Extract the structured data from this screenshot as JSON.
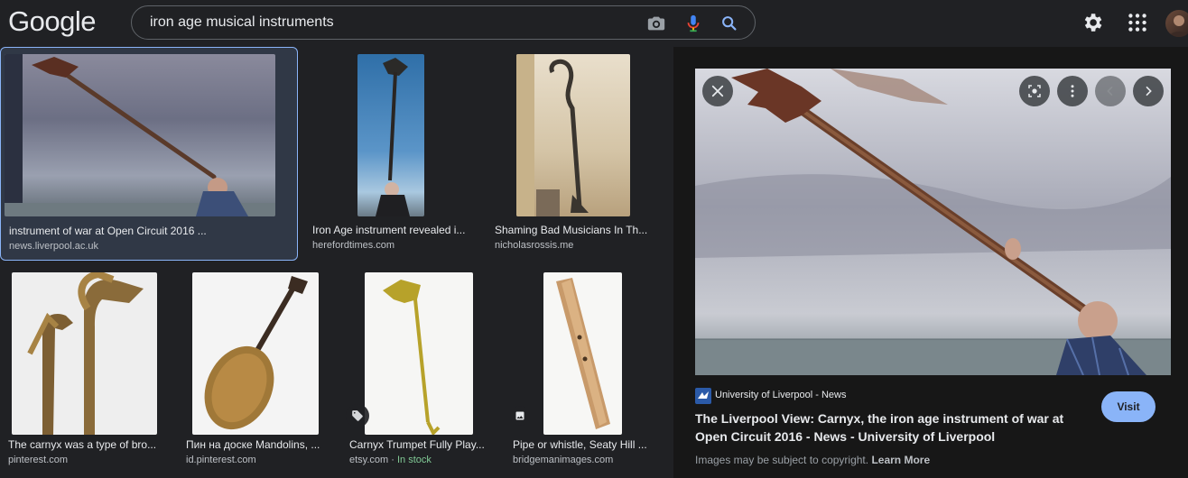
{
  "header": {
    "logo": "Google",
    "query": "iron age musical instruments"
  },
  "results": [
    {
      "caption": "instrument of war at Open Circuit 2016 ...",
      "source": "news.liverpool.ac.uk"
    },
    {
      "caption": "Iron Age instrument revealed i...",
      "source": "herefordtimes.com"
    },
    {
      "caption": "Shaming Bad Musicians In Th...",
      "source": "nicholasrossis.me"
    },
    {
      "caption": "The carnyx was a type of bro...",
      "source": "pinterest.com"
    },
    {
      "caption": "Пин на доске Mandolins, ...",
      "source": "id.pinterest.com"
    },
    {
      "caption": "Carnyx Trumpet Fully Play...",
      "source": "etsy.com",
      "stock_sep": " · ",
      "stock": "In stock"
    },
    {
      "caption": "Pipe or whistle, Seaty Hill ...",
      "source": "bridgemanimages.com"
    }
  ],
  "preview": {
    "site_name": "University of Liverpool - News",
    "title": "The Liverpool View: Carnyx, the iron age instrument of war at Open Circuit 2016 - News - University of Liverpool",
    "visit_label": "Visit",
    "copyright_text": "Images may be subject to copyright.",
    "learn_more": "Learn More"
  },
  "icons": {
    "camera": "camera-icon",
    "mic": "microphone-icon",
    "search": "search-icon",
    "settings": "gear-icon",
    "apps": "apps-grid-icon",
    "close": "close-icon",
    "lens": "lens-icon",
    "more": "more-vert-icon",
    "prev": "chevron-left-icon",
    "next": "chevron-right-icon"
  },
  "colors": {
    "accent": "#8ab4f8",
    "background": "#202124",
    "panel": "#171717",
    "in_stock": "#81c995"
  }
}
